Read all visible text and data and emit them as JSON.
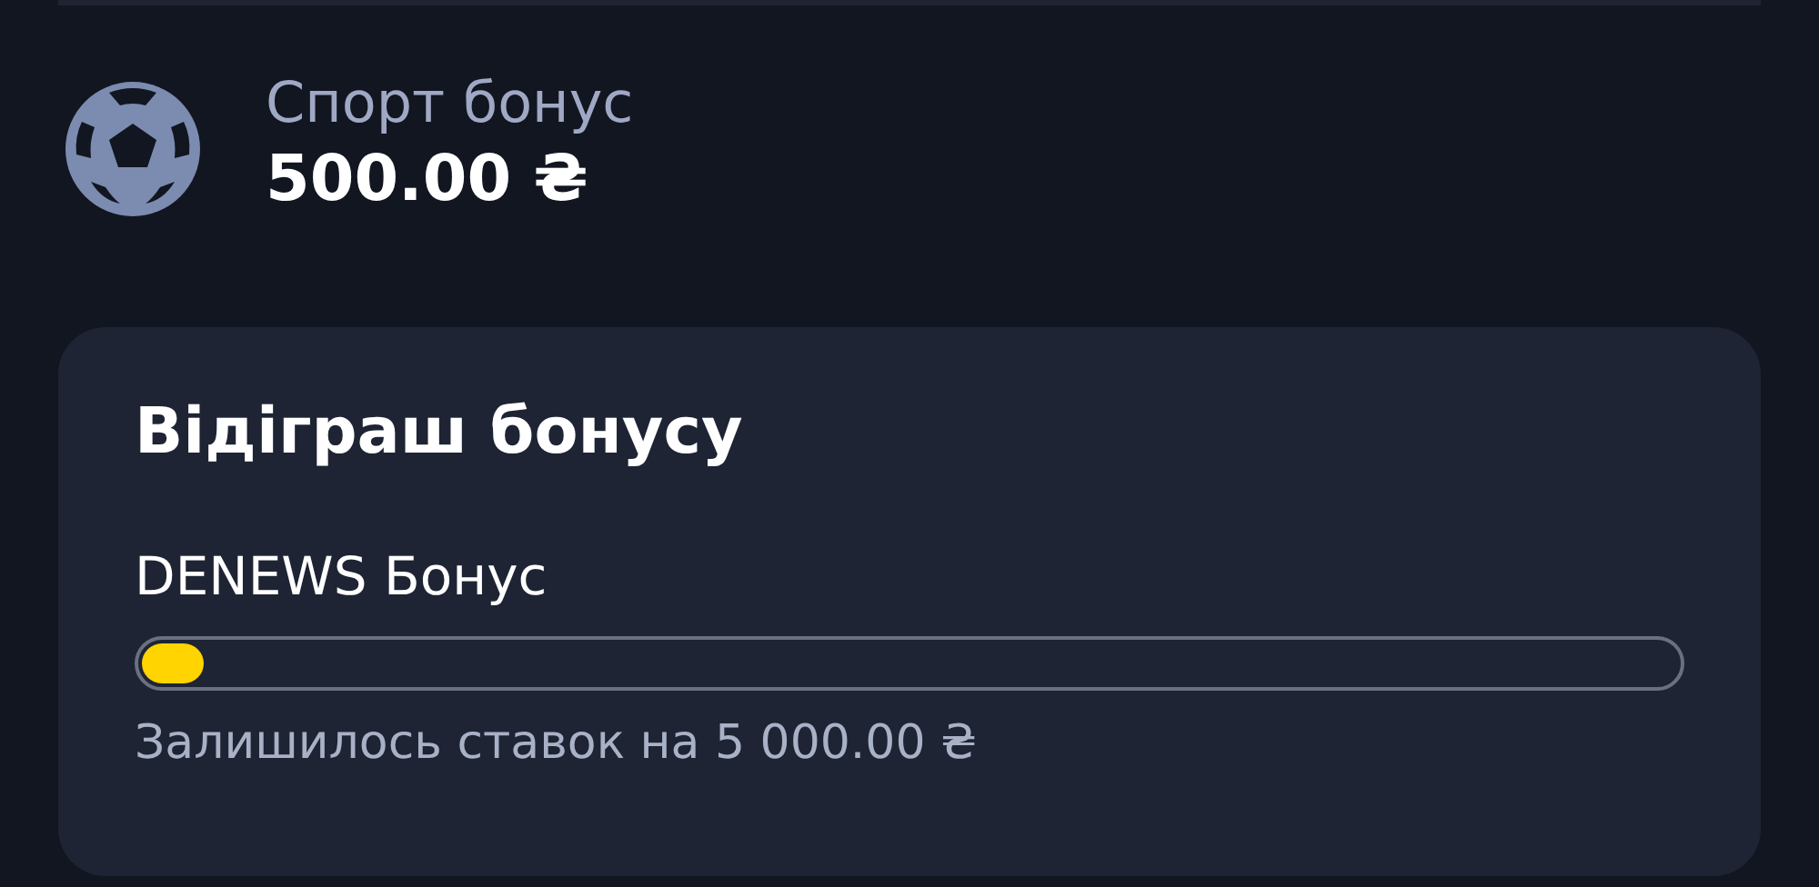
{
  "bonus": {
    "title": "Спорт бонус",
    "amount": "500.00 ₴"
  },
  "wagering": {
    "title": "Відіграш бонусу",
    "name": "DENEWS Бонус",
    "level": 0.04,
    "remaining": "Залишилось ставок на 5 000.00 ₴"
  }
}
